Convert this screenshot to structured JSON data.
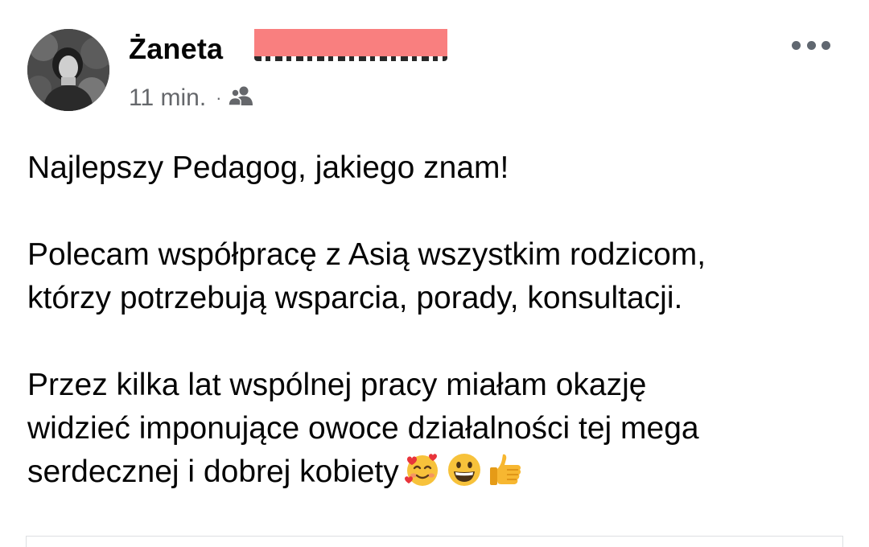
{
  "post": {
    "author": {
      "first_name": "Żaneta",
      "avatar_icon": "profile-photo"
    },
    "meta": {
      "timestamp": "11 min.",
      "separator": "·",
      "audience_icon": "friends-icon"
    },
    "more_icon": "more-horizontal-icon",
    "paragraphs": [
      "Najlepszy Pedagog, jakiego znam!",
      "Polecam współpracę z Asią wszystkim rodzicom,\nktórzy potrzebują wsparcia, porady, konsultacji.",
      "Przez kilka lat wspólnej pracy miałam okazję\nwidzieć imponujące owoce działalności tej mega\nserdecznej i dobrej kobiety"
    ],
    "trailing_emojis": [
      "smiling-face-with-hearts-emoji",
      "grinning-face-emoji",
      "thumbs-up-emoji"
    ]
  },
  "colors": {
    "text": "#050505",
    "secondary_text": "#65676b",
    "redaction": "#f97f7f",
    "icon_gray": "#606770"
  }
}
